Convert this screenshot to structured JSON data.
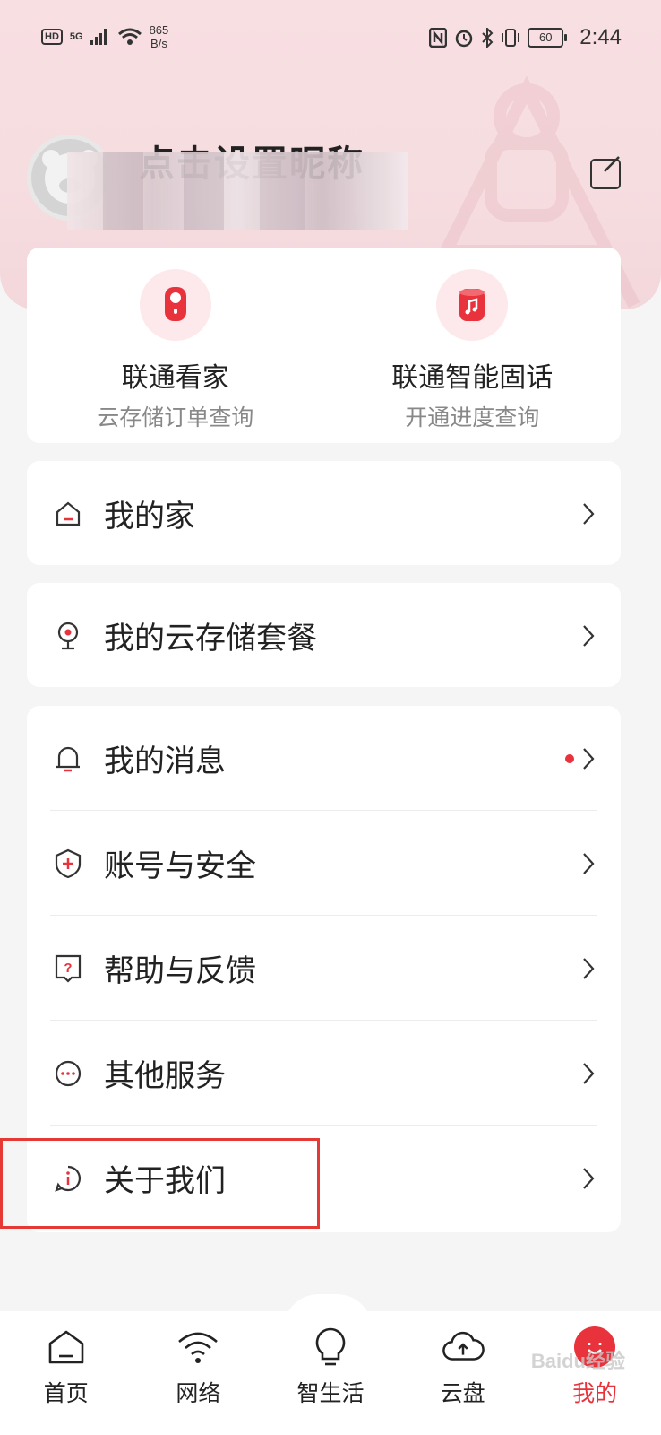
{
  "status_bar": {
    "hd": "HD",
    "network": "5G",
    "speed_value": "865",
    "speed_unit": "B/s",
    "battery": "60",
    "time": "2:44"
  },
  "profile": {
    "nickname": "点击设置昵称"
  },
  "services": [
    {
      "title": "联通看家",
      "subtitle": "云存储订单查询",
      "icon": "camera-icon"
    },
    {
      "title": "联通智能固话",
      "subtitle": "开通进度查询",
      "icon": "phone-speaker-icon"
    }
  ],
  "menu": {
    "my_home": "我的家",
    "cloud_plan": "我的云存储套餐",
    "messages": "我的消息",
    "account_security": "账号与安全",
    "help_feedback": "帮助与反馈",
    "other_services": "其他服务",
    "about_us": "关于我们"
  },
  "tabs": [
    {
      "label": "首页",
      "icon": "home-icon",
      "active": false
    },
    {
      "label": "网络",
      "icon": "wifi-icon",
      "active": false
    },
    {
      "label": "智生活",
      "icon": "bulb-icon",
      "active": false
    },
    {
      "label": "云盘",
      "icon": "cloud-upload-icon",
      "active": false
    },
    {
      "label": "我的",
      "icon": "profile-face-icon",
      "active": true
    }
  ],
  "colors": {
    "accent": "#e8323c",
    "header_bg": "#f8dfe2",
    "highlight_box": "#e53935"
  },
  "watermark": "Baidu经验"
}
